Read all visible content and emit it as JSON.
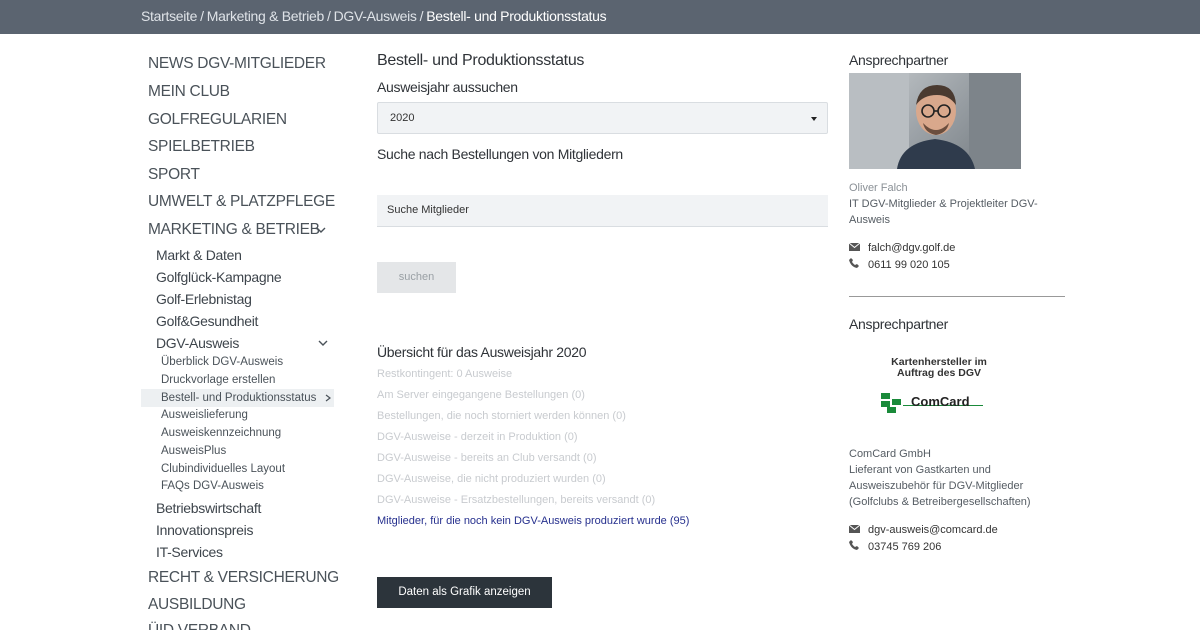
{
  "breadcrumb": {
    "items": [
      "Startseite",
      "Marketing & Betrieb",
      "DGV-Ausweis"
    ],
    "current": "Bestell- und Produktionsstatus",
    "separator": "/"
  },
  "sidebar": {
    "main_items": [
      "NEWS DGV-MITGLIEDER",
      "MEIN CLUB",
      "GOLFREGULARIEN",
      "SPIELBETRIEB",
      "SPORT",
      "UMWELT & PLATZPFLEGE",
      "MARKETING & BETRIEB"
    ],
    "marketing_sub": [
      "Markt & Daten",
      "Golfglück-Kampagne",
      "Golf-Erlebnistag",
      "Golf&Gesundheit",
      "DGV-Ausweis"
    ],
    "ausweis_sub": [
      "Überblick DGV-Ausweis",
      "Druckvorlage erstellen",
      "Bestell- und Produktionsstatus",
      "Ausweislieferung",
      "Ausweiskennzeichnung",
      "AusweisPlus",
      "Clubindividuelles Layout",
      "FAQs DGV-Ausweis"
    ],
    "marketing_sub_after": [
      "Betriebswirtschaft",
      "Innovationspreis",
      "IT-Services"
    ],
    "main_items_after": [
      "RECHT & VERSICHERUNG",
      "AUSBILDUNG",
      "ÜID VERBAND"
    ],
    "active_item": "Bestell- und Produktionsstatus"
  },
  "main": {
    "title": "Bestell- und Produktionsstatus",
    "year_label": "Ausweisjahr aussuchen",
    "year_value": "2020",
    "search_heading": "Suche nach Bestellungen von Mitgliedern",
    "search_placeholder": "Suche Mitglieder",
    "search_button": "suchen",
    "overview_title": "Übersicht für das Ausweisjahr 2020",
    "stats": [
      "Restkontingent: 0 Ausweise",
      "Am Server eingegangene Bestellungen (0)",
      "Bestellungen, die noch storniert werden können (0)",
      "DGV-Ausweise - derzeit in Produktion (0)",
      "DGV-Ausweise - bereits an Club versandt (0)",
      "DGV-Ausweise, die nicht produziert wurden (0)",
      "DGV-Ausweise - Ersatzbestellungen, bereits versandt (0)"
    ],
    "stats_link": "Mitglieder, für die noch kein DGV-Ausweis produziert wurde (95)",
    "chart_button": "Daten als Grafik anzeigen"
  },
  "contact1": {
    "heading": "Ansprechpartner",
    "name": "Oliver Falch",
    "role": "IT DGV-Mitglieder & Projektleiter DGV-Ausweis",
    "email": "falch@dgv.golf.de",
    "phone": "0611 99 020 105"
  },
  "contact2": {
    "heading": "Ansprechpartner",
    "logo_title": "Kartenhersteller im Auftrag des DGV",
    "logo_brand": "ComCard",
    "company": "ComCard GmbH",
    "description": "Lieferant von Gastkarten und Ausweiszubehör für DGV-Mitglieder (Golfclubs & Betreibergesellschaften)",
    "email": "dgv-ausweis@comcard.de",
    "phone": "03745 769 206"
  },
  "colors": {
    "topbar": "#5b6470",
    "link": "#26308e",
    "dark_button": "#2c343b",
    "logo_green": "#1a8a3a"
  }
}
